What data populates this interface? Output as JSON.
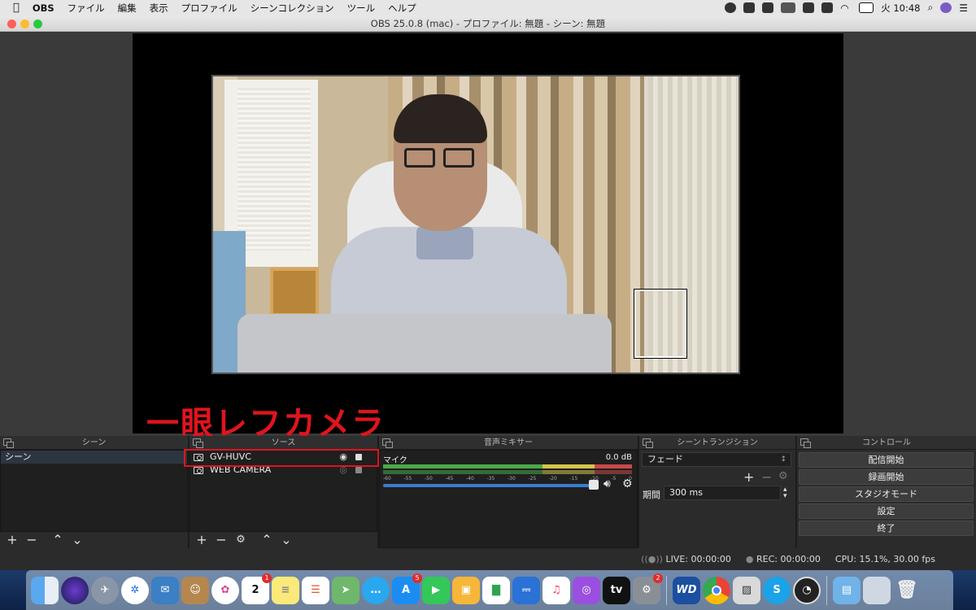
{
  "menubar": {
    "app_name": "OBS",
    "items": [
      "ファイル",
      "編集",
      "表示",
      "プロファイル",
      "シーンコレクション",
      "ツール",
      "ヘルプ"
    ],
    "clock": "火 10:48"
  },
  "window": {
    "title": "OBS 25.0.8 (mac) - プロファイル: 無題 - シーン: 無題"
  },
  "annotation": {
    "text": "一眼レフカメラ",
    "color": "#e0141e"
  },
  "panels": {
    "scenes": {
      "title": "シーン",
      "items": [
        "シーン"
      ]
    },
    "sources": {
      "title": "ソース",
      "items": [
        {
          "label": "GV-HUVC",
          "visible": true,
          "locked": true
        },
        {
          "label": "WEB CAMERA",
          "visible": false,
          "locked": true
        }
      ]
    },
    "mixer": {
      "title": "音声ミキサー",
      "channel": "マイク",
      "level": "0.0 dB",
      "ticks": [
        "-60",
        "-55",
        "-50",
        "-45",
        "-40",
        "-35",
        "-30",
        "-25",
        "-20",
        "-15",
        "-10",
        "-5",
        "0"
      ],
      "volume_fraction": 1.0
    },
    "transitions": {
      "title": "シーントランジション",
      "selected": "フェード",
      "duration_label": "期間",
      "duration_value": "300 ms"
    },
    "controls": {
      "title": "コントロール",
      "buttons": [
        "配信開始",
        "録画開始",
        "スタジオモード",
        "設定",
        "終了"
      ]
    }
  },
  "statusbar": {
    "live": "LIVE: 00:00:00",
    "rec": "REC: 00:00:00",
    "cpu": "CPU: 15.1%, 30.00 fps"
  },
  "dock": {
    "calendar_day": "2",
    "calendar_badge": "1",
    "appstore_badge": "5",
    "prefs_badge": "2",
    "wd_label": "WD",
    "skype_label": "S",
    "tv_label": "tv"
  },
  "colors": {
    "accent_blue": "#3a7ccf",
    "panel_bg": "#2b2b2b",
    "annotation_red": "#e0141e"
  }
}
